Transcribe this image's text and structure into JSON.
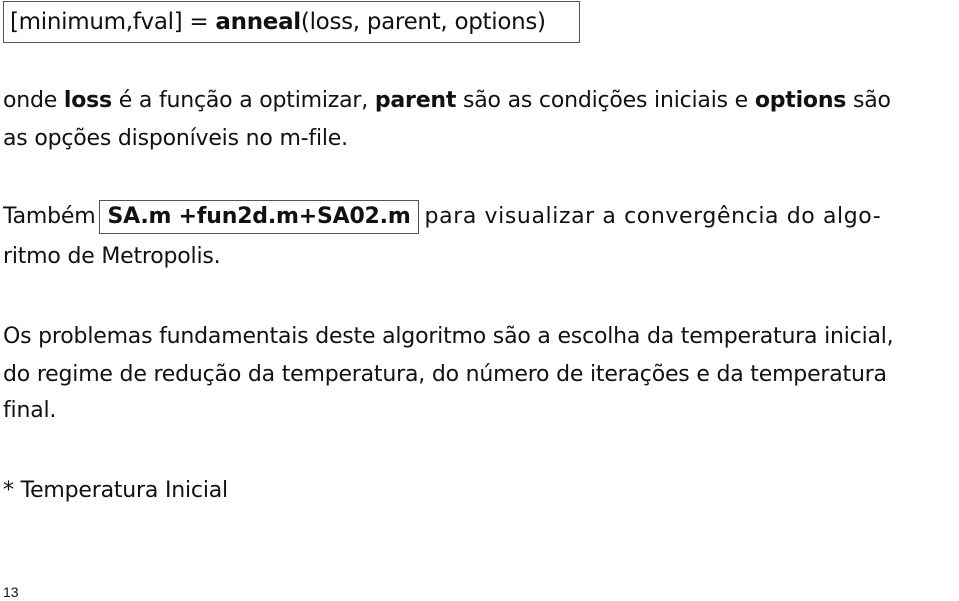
{
  "signature": {
    "outputs": "[minimum,fval]",
    "equals": "=",
    "function": "anneal",
    "args": "(loss, parent, options)"
  },
  "para1": {
    "t1": "onde ",
    "loss": "loss",
    "t2": " é a função a optimizar, ",
    "parent": "parent",
    "t3": " são as condições iniciais e ",
    "options": "options",
    "t4": " são",
    "line2": "as opções disponíveis no m-file."
  },
  "para2": {
    "t1": "Também",
    "files": "SA.m +fun2d.m+SA02.m",
    "t2": "para visualizar a convergência do algo-",
    "line2": "ritmo de Metropolis."
  },
  "para3": {
    "line1": "Os problemas fundamentais deste algoritmo são a escolha da temperatura inicial,",
    "line2": "do regime de redução da temperatura, do número de iterações e da temperatura",
    "line3": "final."
  },
  "heading": "* Temperatura Inicial",
  "page_number": "13"
}
